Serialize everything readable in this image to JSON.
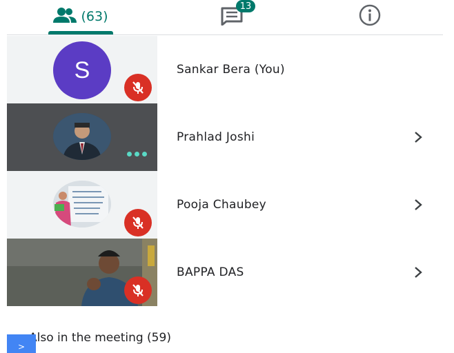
{
  "tabs": {
    "people_count": "(63)",
    "chat_badge": "13"
  },
  "participants": [
    {
      "name": "Sankar Bera (You)",
      "avatar_letter": "S",
      "muted": true
    },
    {
      "name": "Prahlad Joshi",
      "muted": false
    },
    {
      "name": "Pooja Chaubey",
      "muted": true
    },
    {
      "name": "BAPPA DAS",
      "muted": true
    }
  ],
  "footer": {
    "also_label": "Also in the meeting (59)",
    "button_glyph": ">"
  },
  "colors": {
    "accent": "#00796b",
    "avatar": "#5b3cc4",
    "mute": "#d93025",
    "overflow_dots": "#5ad9c5"
  }
}
